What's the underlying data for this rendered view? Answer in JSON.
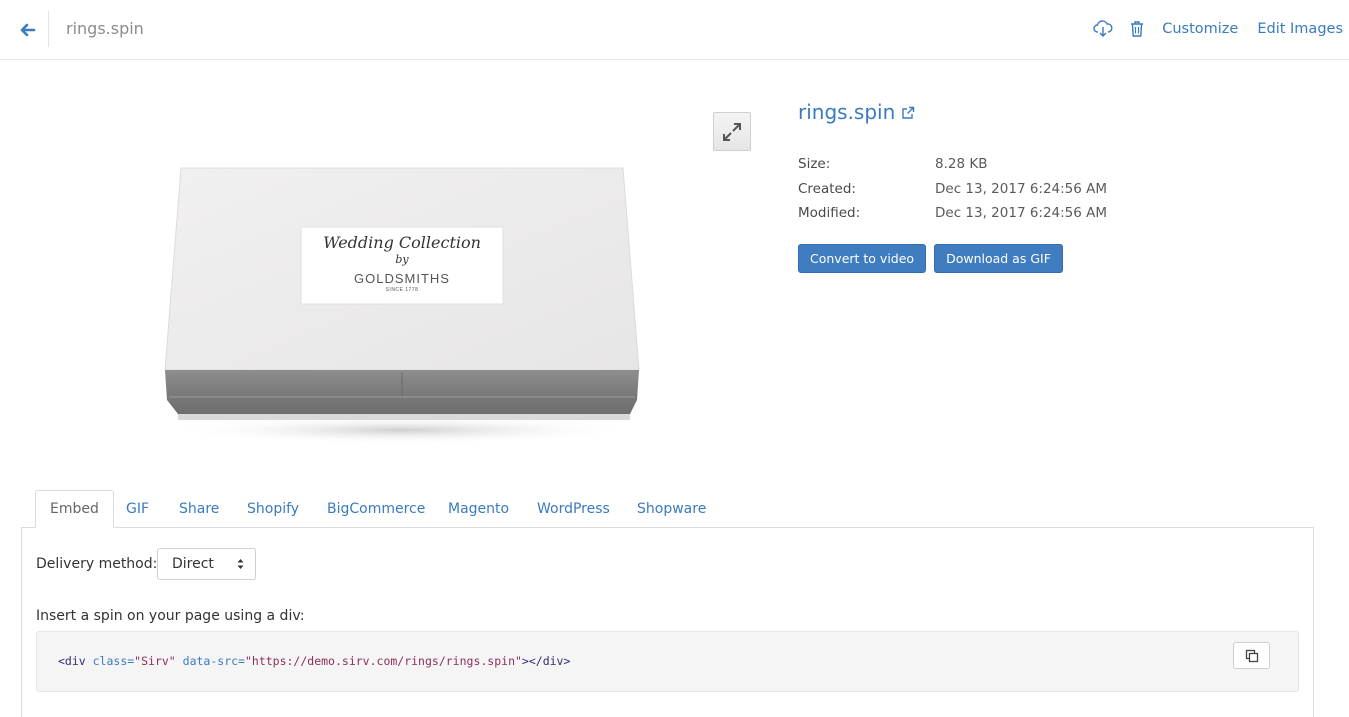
{
  "header": {
    "breadcrumb": "rings.spin",
    "customize_label": "Customize",
    "edit_images_label": "Edit Images",
    "icons": [
      "back-arrow-icon",
      "cloud-download-icon",
      "trash-icon"
    ]
  },
  "preview": {
    "label_script": "Wedding Collection",
    "label_by": "by",
    "label_brand": "GOLDSMITHS",
    "label_since": "SINCE 1778"
  },
  "file": {
    "title": "rings.spin",
    "size_label": "Size:",
    "size": "8.28 KB",
    "created_label": "Created:",
    "created": "Dec 13, 2017 6:24:56 AM",
    "modified_label": "Modified:",
    "modified": "Dec 13, 2017 6:24:56 AM",
    "convert_label": "Convert to video",
    "gif_label": "Download as GIF"
  },
  "tabs": [
    "Embed",
    "GIF",
    "Share",
    "Shopify",
    "BigCommerce",
    "Magento",
    "WordPress",
    "Shopware"
  ],
  "embed": {
    "delivery_label": "Delivery method:",
    "delivery_value": "Direct",
    "insert_label": "Insert a spin on your page using a div:",
    "code_tag_open": "<div ",
    "code_attr_class": "class=",
    "code_val_class": "\"Sirv\"",
    "code_attr_src": "data-src=",
    "code_val_src": "\"https://demo.sirv.com/rings/rings.spin\"",
    "code_tag_close": "></div>"
  },
  "colors": {
    "accent": "#3a7bbf",
    "button": "#3f7dc0"
  }
}
